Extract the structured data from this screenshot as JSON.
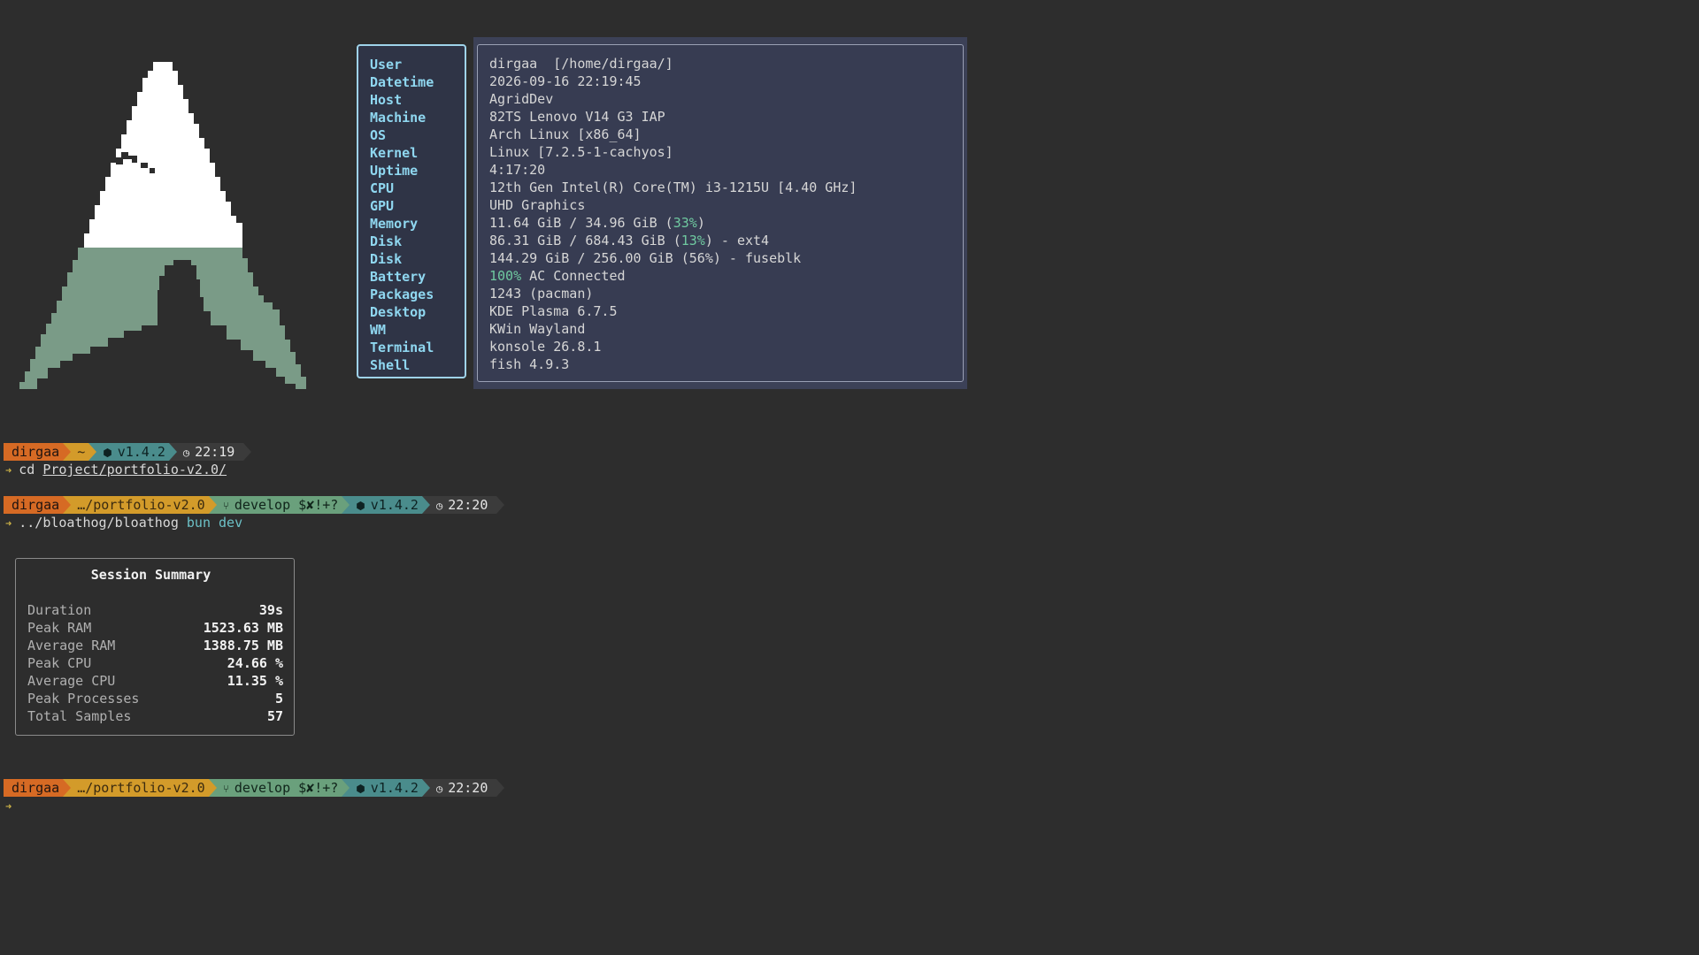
{
  "fetch": {
    "labels": [
      "User",
      "Datetime",
      "Host",
      "Machine",
      "OS",
      "Kernel",
      "Uptime",
      "CPU",
      "GPU",
      "Memory",
      "Disk",
      "Disk",
      "Battery",
      "Packages",
      "Desktop",
      "WM",
      "Terminal",
      "Shell"
    ],
    "user": "dirgaa  [/home/dirgaa/]",
    "datetime": "2026-09-16 22:19:45",
    "host": "AgridDev",
    "machine": "82TS Lenovo V14 G3 IAP",
    "os": "Arch Linux [x86_64]",
    "kernel": "Linux [7.2.5-1-cachyos]",
    "uptime": "4:17:20",
    "cpu": "12th Gen Intel(R) Core(TM) i3-1215U [4.40 GHz]",
    "gpu": "UHD Graphics",
    "memory": {
      "pre": "11.64 GiB / 34.96 GiB (",
      "pct": "33%",
      "post": ")"
    },
    "disk1": {
      "pre": "86.31 GiB / 684.43 GiB (",
      "pct": "13%",
      "post": ") - ext4"
    },
    "disk2": "144.29 GiB / 256.00 GiB (56%) - fuseblk",
    "battery": {
      "pct": "100%",
      "post": " AC Connected"
    },
    "packages": "1243 (pacman)",
    "desktop": "KDE Plasma 6.7.5",
    "wm": "KWin Wayland",
    "terminal": "konsole 26.8.1",
    "shell": "fish 4.9.3"
  },
  "prompt1": {
    "user": "dirgaa",
    "path": "~",
    "node_version": "v1.4.2",
    "time": "22:19",
    "command": "cd",
    "arg": "Project/portfolio-v2.0/"
  },
  "prompt2": {
    "user": "dirgaa",
    "path": "…/portfolio-v2.0",
    "branch": "develop $✘!+?",
    "node_version": "v1.4.2",
    "time": "22:20",
    "command": "../bloathog/bloathog",
    "args": "bun dev"
  },
  "summary": {
    "title": "Session Summary",
    "rows": [
      {
        "k": "Duration",
        "v": "39s"
      },
      {
        "k": "Peak RAM",
        "v": "1523.63 MB"
      },
      {
        "k": "Average RAM",
        "v": "1388.75 MB"
      },
      {
        "k": "Peak CPU",
        "v": "24.66 %"
      },
      {
        "k": "Average CPU",
        "v": "11.35 %"
      },
      {
        "k": "Peak Processes",
        "v": "5"
      },
      {
        "k": "Total Samples",
        "v": "57"
      }
    ]
  },
  "prompt3": {
    "user": "dirgaa",
    "path": "…/portfolio-v2.0",
    "branch": "develop $✘!+?",
    "node_version": "v1.4.2",
    "time": "22:20"
  },
  "colors": {
    "background": "#2d2d2d",
    "label": "#8fd7f0",
    "highlight": "#6fc9a0",
    "user_segment": "#d66a24",
    "path_segment": "#d39b2a",
    "git_segment": "#6aa07c",
    "node_segment": "#4a8c8c"
  },
  "icons": {
    "git": "git-branch-icon",
    "node": "node-icon",
    "clock": "clock-icon",
    "arrow": "prompt-arrow-icon",
    "logo": "arch-linux-logo"
  }
}
